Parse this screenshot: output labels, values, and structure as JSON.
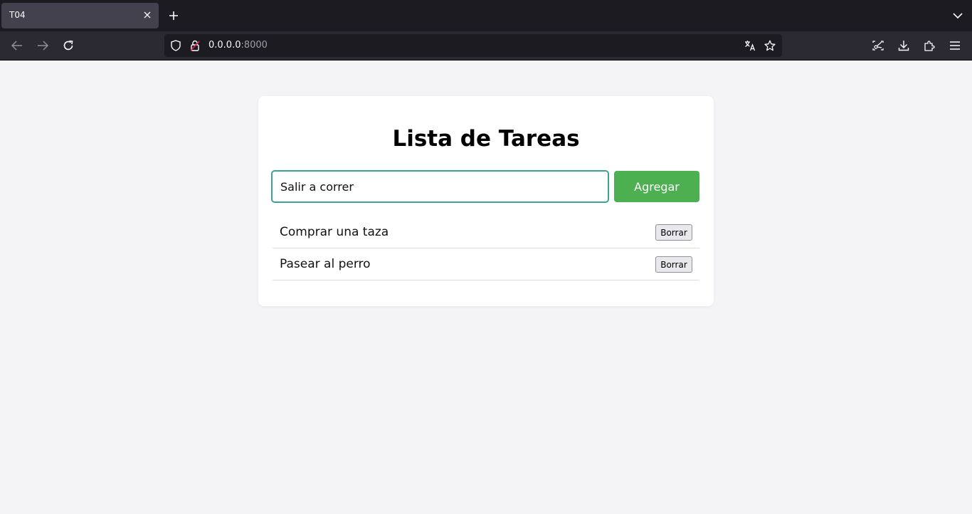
{
  "browser": {
    "tab_title": "T04",
    "url_host": "0.0.0.0",
    "url_port": ":8000"
  },
  "page": {
    "title": "Lista de Tareas",
    "input_value": "Salir a correr",
    "add_button": "Agregar",
    "tasks": [
      {
        "text": "Comprar una taza",
        "delete_label": "Borrar"
      },
      {
        "text": "Pasear al perro",
        "delete_label": "Borrar"
      }
    ]
  },
  "colors": {
    "accent_green": "#4caf50",
    "input_focus": "#3aa58f",
    "chrome_dark": "#1c1b22",
    "chrome_nav": "#2b2a33",
    "page_bg": "#f4f4f7"
  },
  "icons": [
    "close-icon",
    "plus-icon",
    "chevron-down-icon",
    "back-arrow-icon",
    "forward-arrow-icon",
    "reload-icon",
    "shield-icon",
    "lock-icon",
    "translate-icon",
    "star-icon",
    "screenshot-icon",
    "download-icon",
    "extensions-icon",
    "menu-icon"
  ]
}
